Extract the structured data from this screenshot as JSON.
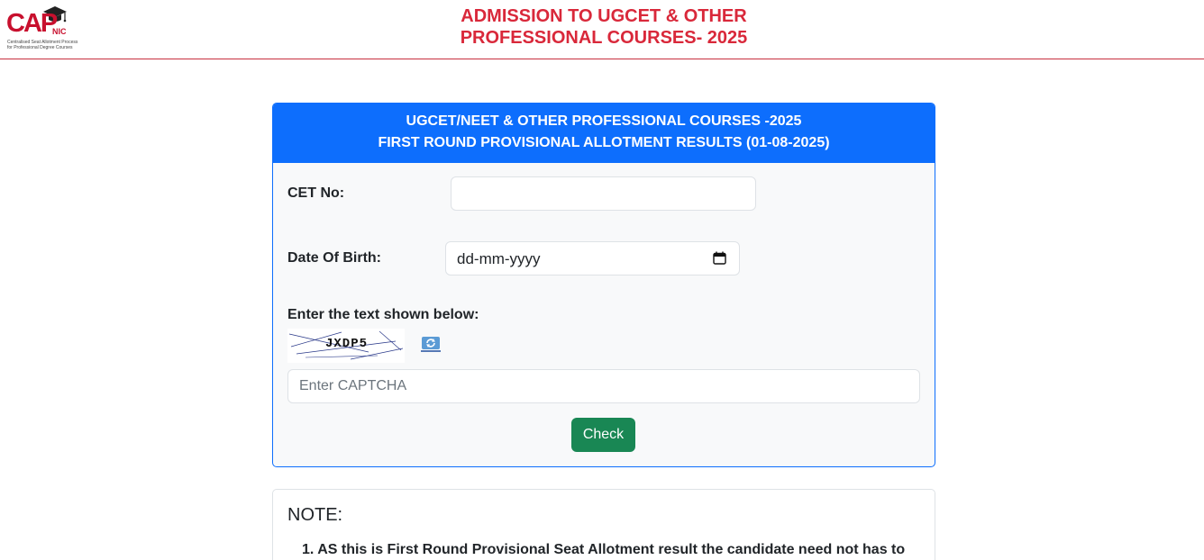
{
  "header": {
    "logo_text": "CAP",
    "logo_sub_text": "NIC",
    "logo_tagline_1": "Centralised Seat Allotment Process",
    "logo_tagline_2": "for Professional Degree Courses",
    "title_line1": "ADMISSION TO UGCET & OTHER",
    "title_line2": "PROFESSIONAL COURSES- 2025"
  },
  "form_card": {
    "heading_line1": "UGCET/NEET & OTHER PROFESSIONAL COURSES -2025",
    "heading_line2": "FIRST ROUND PROVISIONAL ALLOTMENT RESULTS (01-08-2025)",
    "cet_no_label": "CET No:",
    "cet_no_value": "",
    "dob_label": "Date Of Birth:",
    "dob_placeholder": "dd-mm-yyyy",
    "captcha_label": "Enter the text shown below:",
    "captcha_image_text": "JXDP5",
    "captcha_placeholder": "Enter CAPTCHA",
    "check_button": "Check"
  },
  "note": {
    "title": "NOTE:",
    "items": [
      "1. AS this is First Round Provisional Seat Allotment result the candidate need not has to"
    ]
  },
  "colors": {
    "brand_red": "#d9283a",
    "header_blue": "#0d6efd",
    "button_green": "#198754"
  },
  "icons": {
    "logo": "graduation-cap-icon",
    "calendar": "calendar-icon",
    "refresh": "refresh-icon"
  }
}
